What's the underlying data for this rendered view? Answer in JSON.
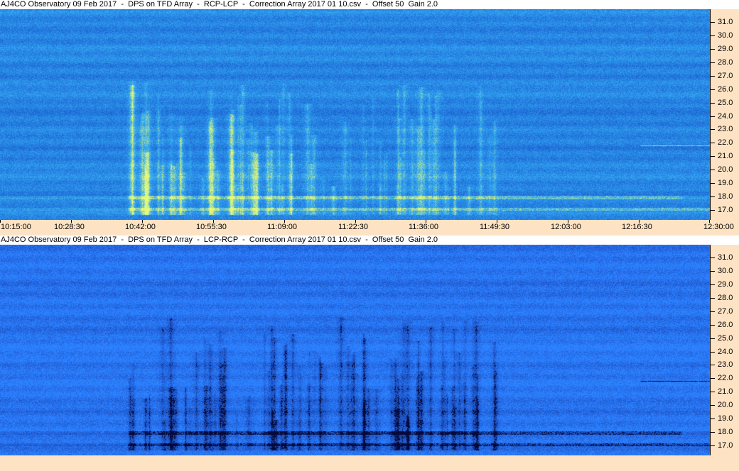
{
  "panels": [
    {
      "title": "AJ4CO Observatory 09 Feb 2017  -  DPS on TFD Array  -  RCP-LCP  -  Correction Array 2017 01 10.csv  -  Offset 50  Gain 2.0",
      "palette": "bright",
      "y_ticks": [
        "31.0",
        "30.0",
        "29.0",
        "28.0",
        "27.0",
        "26.0",
        "25.0",
        "24.0",
        "23.0",
        "22.0",
        "21.0",
        "20.0",
        "19.0",
        "18.0",
        "17.0"
      ]
    },
    {
      "title": "AJ4CO Observatory 09 Feb 2017  -  DPS on TFD Array  -  LCP-RCP  -  Correction Array 2017 01 10.csv  -  Offset 50  Gain 2.0",
      "palette": "dark",
      "y_ticks": [
        "31.0",
        "30.0",
        "29.0",
        "28.0",
        "27.0",
        "26.0",
        "25.0",
        "24.0",
        "23.0",
        "22.0",
        "21.0",
        "20.0",
        "19.0",
        "18.0",
        "17.0"
      ]
    }
  ],
  "time_axis": {
    "labels": [
      "10:15:00",
      "10:28:30",
      "10:42:00",
      "10:55:30",
      "11:09:00",
      "11:22:30",
      "11:36:00",
      "11:49:30",
      "12:03:00",
      "12:16:30",
      "12:30:00"
    ]
  },
  "colors": {
    "axis_bg": "#fde3c4",
    "bright_base": "#2a6fe0",
    "dark_base": "#1e4fd0"
  }
}
